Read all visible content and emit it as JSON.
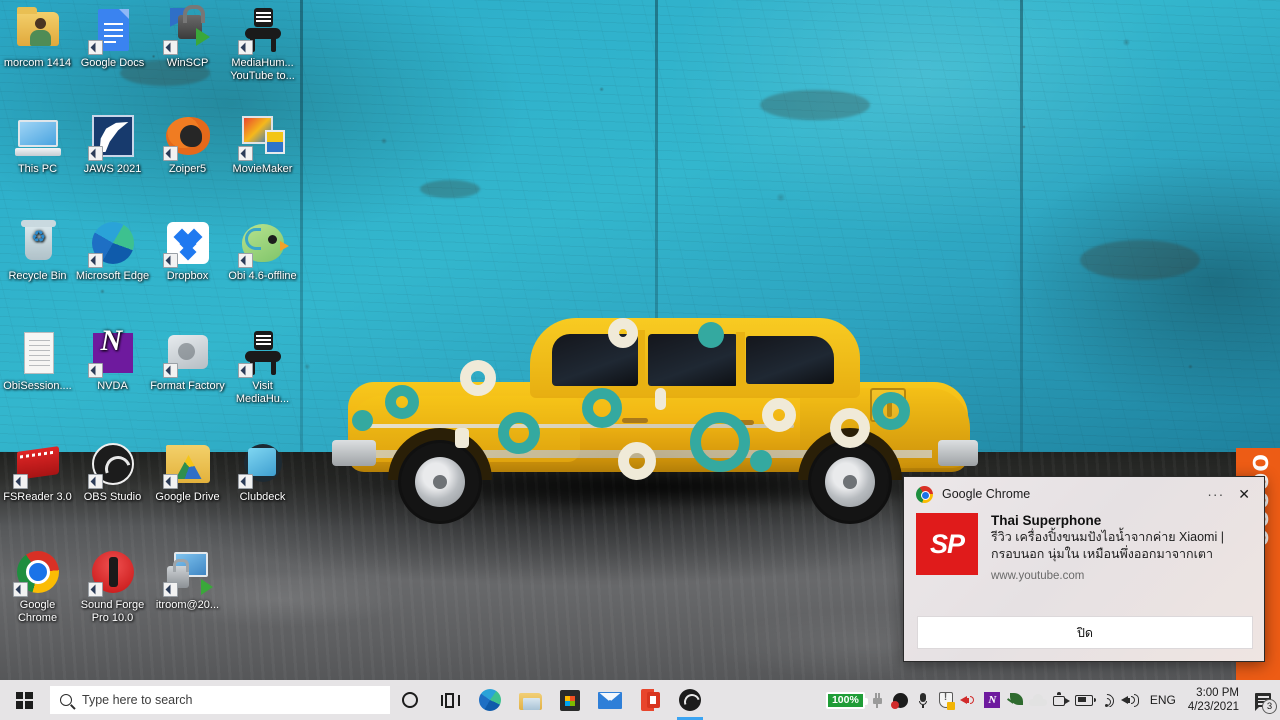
{
  "desktop": {
    "icons": [
      {
        "label": "morcom\n1414",
        "art": "folder-person",
        "name": "morcom-1414",
        "shortcut": false
      },
      {
        "label": "Google Docs",
        "art": "gdoc",
        "name": "google-docs",
        "shortcut": true
      },
      {
        "label": "WinSCP",
        "art": "winscp",
        "name": "winscp",
        "shortcut": true
      },
      {
        "label": "MediaHum...\nYouTube to...",
        "art": "mediahuman",
        "name": "mediahuman-youtube-to",
        "shortcut": true
      },
      {
        "label": "This PC",
        "art": "thispc",
        "name": "this-pc",
        "shortcut": false
      },
      {
        "label": "JAWS 2021",
        "art": "jaws",
        "name": "jaws-2021",
        "shortcut": true
      },
      {
        "label": "Zoiper5",
        "art": "zoiper",
        "name": "zoiper5",
        "shortcut": true
      },
      {
        "label": "MovieMaker",
        "art": "moviemaker",
        "name": "moviemaker",
        "shortcut": true
      },
      {
        "label": "Recycle Bin",
        "art": "recyclebin",
        "name": "recycle-bin",
        "shortcut": false
      },
      {
        "label": "Microsoft\nEdge",
        "art": "edge",
        "name": "microsoft-edge",
        "shortcut": true
      },
      {
        "label": "Dropbox",
        "art": "dropbox",
        "name": "dropbox",
        "shortcut": true
      },
      {
        "label": "Obi\n4.6-offline",
        "art": "obi",
        "name": "obi-46-offline",
        "shortcut": true
      },
      {
        "label": "ObiSession....",
        "art": "document",
        "name": "obisession-file",
        "shortcut": false
      },
      {
        "label": "NVDA",
        "art": "nvda",
        "name": "nvda",
        "shortcut": true
      },
      {
        "label": "Format\nFactory",
        "art": "formatfactory",
        "name": "format-factory",
        "shortcut": true
      },
      {
        "label": "Visit\nMediaHu...",
        "art": "mediahuman",
        "name": "visit-mediahuman",
        "shortcut": true
      },
      {
        "label": "FSReader 3.0",
        "art": "fsreader",
        "name": "fsreader-30",
        "shortcut": true
      },
      {
        "label": "OBS Studio",
        "art": "obs",
        "name": "obs-studio",
        "shortcut": true
      },
      {
        "label": "Google Drive",
        "art": "gdrive",
        "name": "google-drive",
        "shortcut": true
      },
      {
        "label": "Clubdeck",
        "art": "clubdeck",
        "name": "clubdeck",
        "shortcut": true
      },
      {
        "label": "Google\nChrome",
        "art": "chrome",
        "name": "google-chrome",
        "shortcut": true
      },
      {
        "label": "Sound Forge\nPro 10.0",
        "art": "soundforge",
        "name": "sound-forge-pro-100",
        "shortcut": true
      },
      {
        "label": "itroom@20...",
        "art": "rdp",
        "name": "itroom-rdp",
        "shortcut": true
      }
    ]
  },
  "wallpaper": {
    "description": "vintage yellow car with teal and cream circle pattern parked against a weathered turquoise wall",
    "wall_color": "#2fb1cb",
    "car_color": "#f2b714",
    "ring_teal": "#34a9a0",
    "ring_cream": "#f0ead8",
    "ground_color": "#5d5e60"
  },
  "orange_window": {
    "text": "ooooo"
  },
  "toast": {
    "app_name": "Google Chrome",
    "more_label": "···",
    "close_label": "✕",
    "thumb_text": "SP",
    "title": "Thai Superphone",
    "message": "รีวิว เครื่องปิ้งขนมปังไอน้ำจากค่าย Xiaomi | กรอบนอก นุ่มใน เหมือนพึ่งออกมาจากเตา",
    "url": "www.youtube.com",
    "button_label": "ปิด",
    "accent_color": "#e01b1b"
  },
  "taskbar": {
    "start_name": "start-button",
    "search_placeholder": "Type here to search",
    "apps": [
      {
        "name": "cortana-button",
        "art": "cortana"
      },
      {
        "name": "task-view-button",
        "art": "taskview"
      },
      {
        "name": "taskbar-edge",
        "art": "edge"
      },
      {
        "name": "taskbar-file-explorer",
        "art": "explorer"
      },
      {
        "name": "taskbar-microsoft-store",
        "art": "store"
      },
      {
        "name": "taskbar-mail",
        "art": "mail"
      },
      {
        "name": "taskbar-office",
        "art": "office"
      },
      {
        "name": "taskbar-obs-studio",
        "art": "obs",
        "active": true
      }
    ],
    "tray": {
      "battery_percent": "100%",
      "icons": [
        {
          "name": "power-plug-icon",
          "art": "plug"
        },
        {
          "name": "obs-tray-icon",
          "art": "obs"
        },
        {
          "name": "microphone-icon",
          "art": "mic"
        },
        {
          "name": "security-shield-icon",
          "art": "shield"
        },
        {
          "name": "volume-red-icon",
          "art": "spk-red"
        },
        {
          "name": "nvda-tray-icon",
          "art": "nvda"
        },
        {
          "name": "leaf-icon",
          "art": "leaf"
        },
        {
          "name": "onedrive-cloud-icon",
          "art": "cloud"
        },
        {
          "name": "camera-icon",
          "art": "cam"
        },
        {
          "name": "battery-tray-icon",
          "art": "batt"
        },
        {
          "name": "wifi-icon",
          "art": "wifi"
        },
        {
          "name": "volume-icon",
          "art": "spk"
        }
      ],
      "language": "ENG",
      "time": "3:00 PM",
      "date": "4/23/2021",
      "notification_count": "3"
    }
  }
}
